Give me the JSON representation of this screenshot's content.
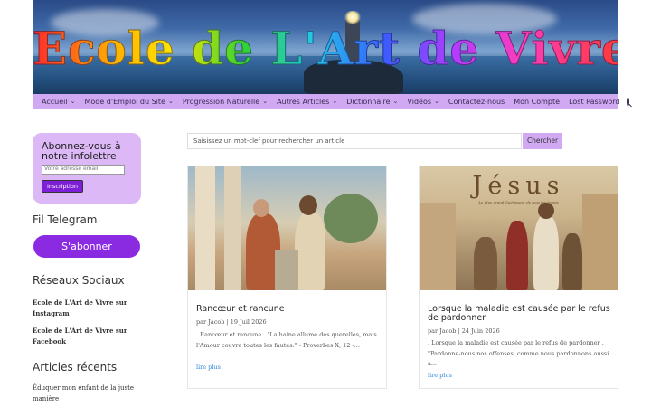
{
  "banner": {
    "title": "Ecole de L'Art de Vivre"
  },
  "nav": {
    "items": [
      {
        "label": "Accueil",
        "dropdown": true
      },
      {
        "label": "Mode d'Emploi du Site",
        "dropdown": true
      },
      {
        "label": "Progression Naturelle",
        "dropdown": true
      },
      {
        "label": "Autres Articles",
        "dropdown": true
      },
      {
        "label": "Dictionnaire",
        "dropdown": true
      },
      {
        "label": "Vidéos",
        "dropdown": true
      },
      {
        "label": "Contactez-nous",
        "dropdown": false
      },
      {
        "label": "Mon Compte",
        "dropdown": false
      },
      {
        "label": "Lost Password",
        "dropdown": false
      }
    ],
    "chevron": "⌄",
    "search_icon": "search-icon"
  },
  "sidebar": {
    "newsletter": {
      "title": "Abonnez-vous à notre infolettre",
      "email_placeholder": "Votre adresse email",
      "submit_label": "Inscription"
    },
    "telegram": {
      "heading": "Fil Telegram",
      "button_label": "S'abonner"
    },
    "social": {
      "heading": "Réseaux Sociaux",
      "links": [
        "Ecole de L'Art de Vivre sur Instagram",
        "Ecole de L'Art de Vivre sur Facebook"
      ]
    },
    "recent": {
      "heading": "Articles récents",
      "items": [
        "Éduquer mon enfant de la juste manière"
      ]
    }
  },
  "search": {
    "placeholder": "Saisissez un mot-clef pour rechercher un article",
    "button_label": "Chercher"
  },
  "posts": [
    {
      "title": "Rancœur et rancune",
      "meta": "par Jacob | 19 Juil 2026",
      "excerpt": ". Rancœur et rancune . \"La haine allume des querelles, mais l'Amour couvre toutes les fautes.\" - Proverbes X, 12 -...",
      "more": "lire plus"
    },
    {
      "title": "Lorsque la maladie est causée par le refus de pardonner",
      "meta": "par Jacob | 24 Juin 2026",
      "excerpt": ". Lorsque la maladie est causée par le refus de pardonner . \"Pardonne-nous nos offenses, comme nous pardonnons aussi à...",
      "more": "lire plus",
      "image_title": "Jésus",
      "image_subtitle": "Le plus grand Guérisseur de tous les temps"
    }
  ],
  "colors": {
    "accent": "#d1a9f2",
    "newsletter_bg": "#dcb8f6",
    "button_purple": "#8a2be2",
    "link_blue": "#2b87da"
  }
}
